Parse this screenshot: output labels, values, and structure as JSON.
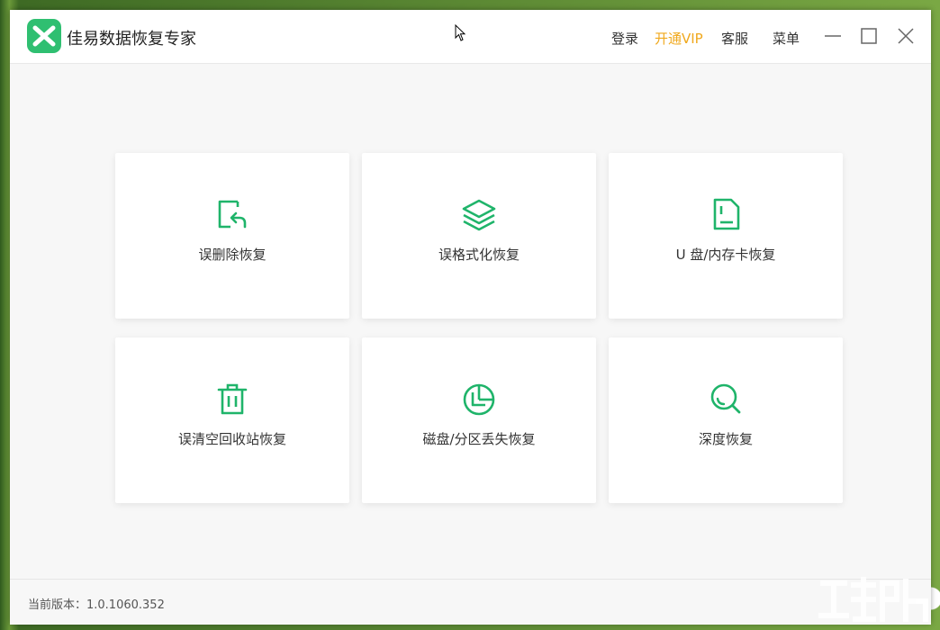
{
  "app": {
    "title": "佳易数据恢复专家"
  },
  "header": {
    "login_label": "登录",
    "vip_label": "开通VIP",
    "service_label": "客服",
    "menu_label": "菜单"
  },
  "cards": [
    {
      "label": "误删除恢复",
      "icon": "file-undo-icon"
    },
    {
      "label": "误格式化恢复",
      "icon": "layers-icon"
    },
    {
      "label": "U 盘/内存卡恢复",
      "icon": "sd-card-icon"
    },
    {
      "label": "误清空回收站恢复",
      "icon": "trash-icon"
    },
    {
      "label": "磁盘/分区丢失恢复",
      "icon": "pie-chart-icon"
    },
    {
      "label": "深度恢复",
      "icon": "magnifier-icon"
    }
  ],
  "footer": {
    "version_text": "当前版本：1.0.1060.352"
  },
  "colors": {
    "accent": "#2fbf71",
    "vip": "#f0a81c",
    "icon_green": "#1fb46a"
  }
}
